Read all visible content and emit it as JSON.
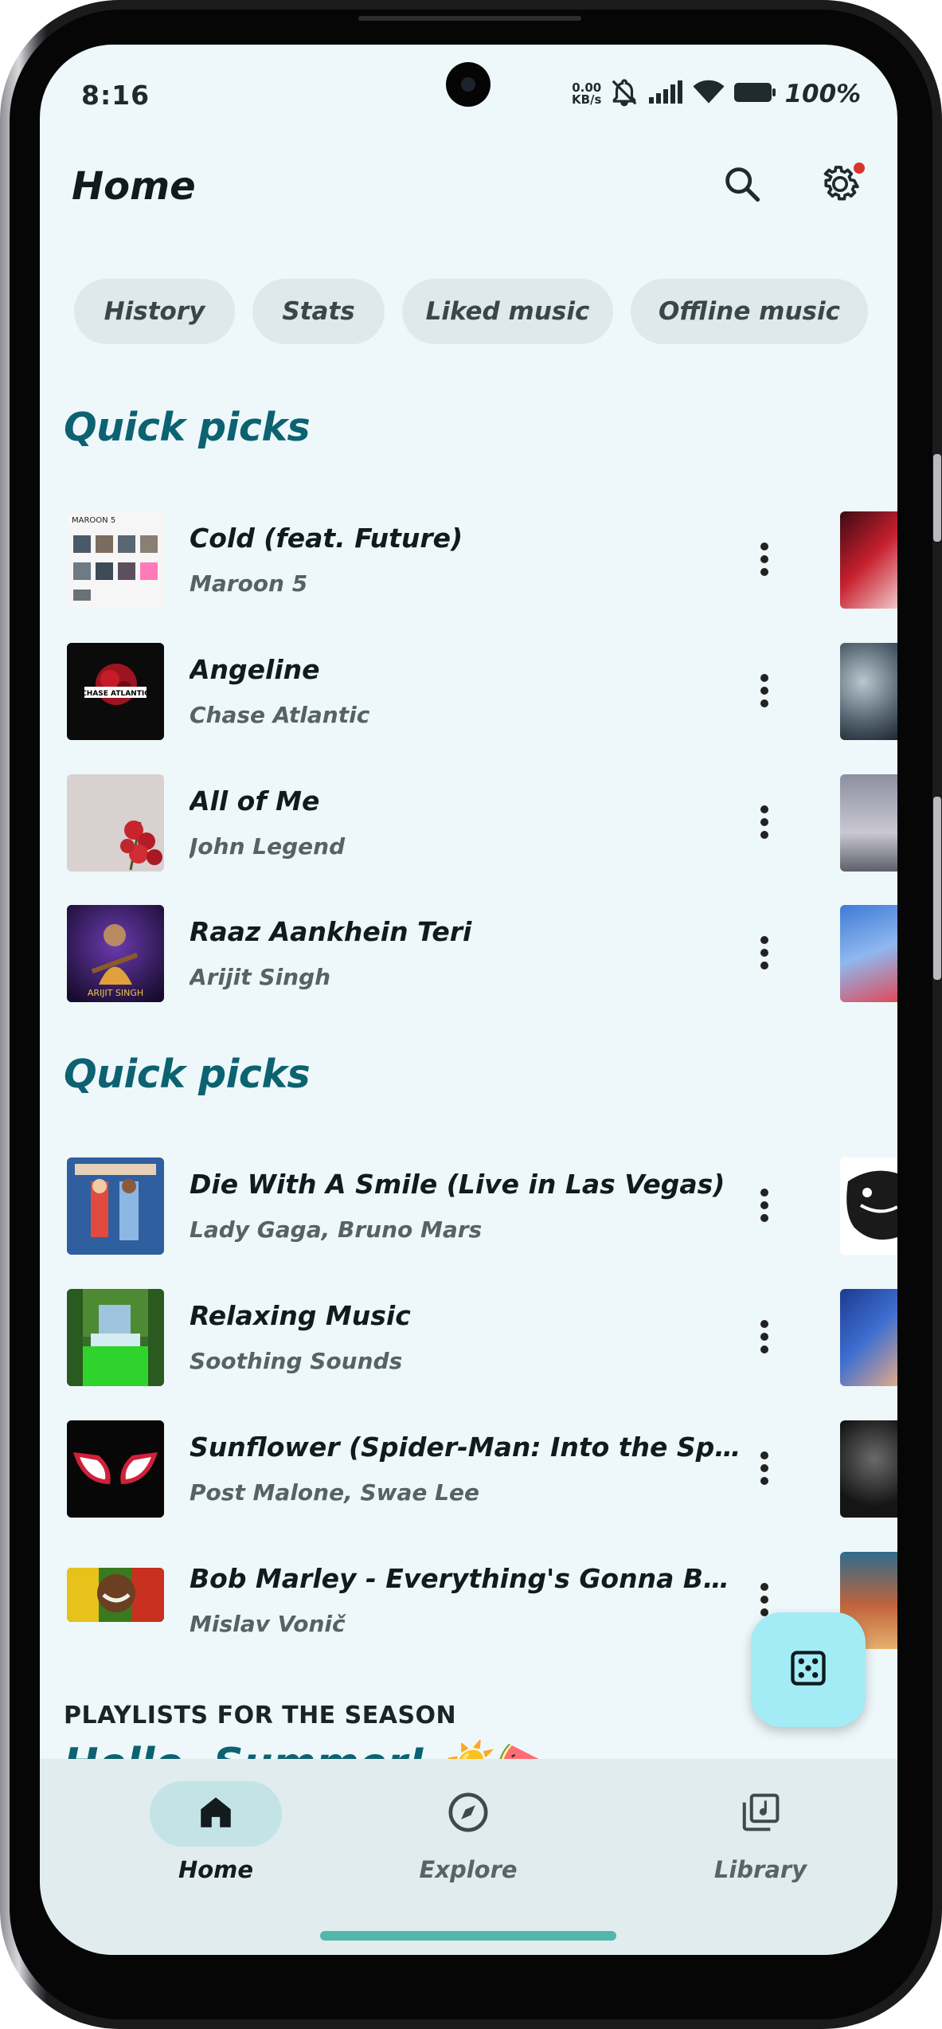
{
  "status_bar": {
    "time": "8:16",
    "net_speed_value": "0.00",
    "net_speed_unit": "KB/s",
    "battery": "100%"
  },
  "header": {
    "title": "Home"
  },
  "chips": [
    "History",
    "Stats",
    "Liked music",
    "Offline music"
  ],
  "sections": [
    {
      "title": "Quick picks",
      "songs": [
        {
          "title": "Cold (feat. Future)",
          "artist": "Maroon 5"
        },
        {
          "title": "Angeline",
          "artist": "Chase Atlantic"
        },
        {
          "title": "All of Me",
          "artist": "John Legend"
        },
        {
          "title": "Raaz Aankhein Teri",
          "artist": "Arijit Singh"
        }
      ]
    },
    {
      "title": "Quick picks",
      "songs": [
        {
          "title": "Die With A Smile (Live in Las Vegas)",
          "artist": "Lady Gaga, Bruno Mars"
        },
        {
          "title": "Relaxing Music",
          "artist": "Soothing Sounds"
        },
        {
          "title": "Sunflower (Spider-Man: Into the Spider-Verse)",
          "artist": "Post Malone, Swae Lee"
        },
        {
          "title": "Bob Marley - Everything's Gonna Be Alright",
          "artist": "Mislav Vonič"
        }
      ]
    }
  ],
  "season": {
    "label": "PLAYLISTS FOR THE SEASON",
    "title": "Hello, Summer! ☀️🍉"
  },
  "bottom_nav": [
    {
      "label": "Home",
      "icon": "home-icon",
      "active": true
    },
    {
      "label": "Explore",
      "icon": "compass-icon",
      "active": false
    },
    {
      "label": "Library",
      "icon": "library-music-icon",
      "active": false
    }
  ],
  "colors": {
    "background": "#eef8fb",
    "accent": "#0c6270",
    "chip": "#dfe8ea",
    "fab": "#a3ecf6",
    "nav_bar": "#e1ecee",
    "nav_active": "#c3e3e7",
    "home_indicator": "#52b7aa"
  }
}
